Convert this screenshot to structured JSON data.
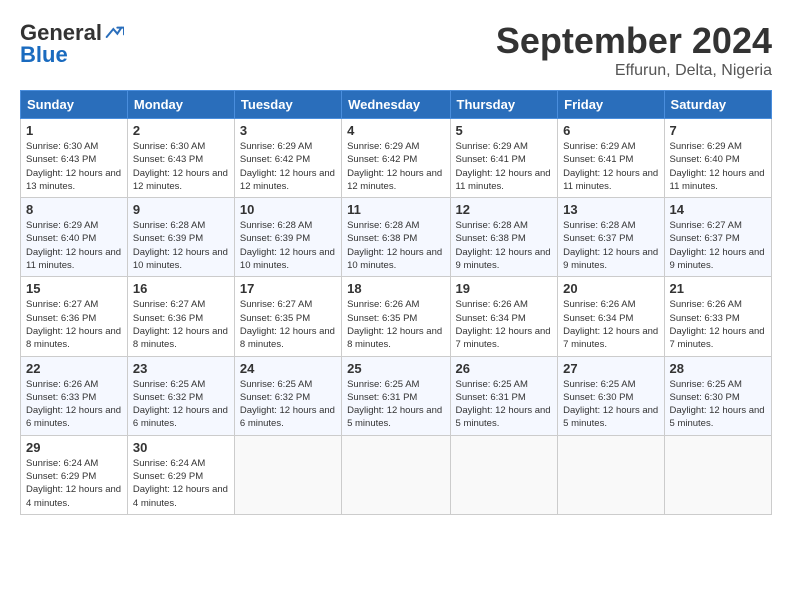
{
  "logo": {
    "general": "General",
    "blue": "Blue"
  },
  "header": {
    "month": "September 2024",
    "location": "Effurun, Delta, Nigeria"
  },
  "days": [
    "Sunday",
    "Monday",
    "Tuesday",
    "Wednesday",
    "Thursday",
    "Friday",
    "Saturday"
  ],
  "weeks": [
    [
      {
        "day": "1",
        "sunrise": "6:30 AM",
        "sunset": "6:43 PM",
        "daylight": "12 hours and 13 minutes."
      },
      {
        "day": "2",
        "sunrise": "6:30 AM",
        "sunset": "6:43 PM",
        "daylight": "12 hours and 12 minutes."
      },
      {
        "day": "3",
        "sunrise": "6:29 AM",
        "sunset": "6:42 PM",
        "daylight": "12 hours and 12 minutes."
      },
      {
        "day": "4",
        "sunrise": "6:29 AM",
        "sunset": "6:42 PM",
        "daylight": "12 hours and 12 minutes."
      },
      {
        "day": "5",
        "sunrise": "6:29 AM",
        "sunset": "6:41 PM",
        "daylight": "12 hours and 11 minutes."
      },
      {
        "day": "6",
        "sunrise": "6:29 AM",
        "sunset": "6:41 PM",
        "daylight": "12 hours and 11 minutes."
      },
      {
        "day": "7",
        "sunrise": "6:29 AM",
        "sunset": "6:40 PM",
        "daylight": "12 hours and 11 minutes."
      }
    ],
    [
      {
        "day": "8",
        "sunrise": "6:29 AM",
        "sunset": "6:40 PM",
        "daylight": "12 hours and 11 minutes."
      },
      {
        "day": "9",
        "sunrise": "6:28 AM",
        "sunset": "6:39 PM",
        "daylight": "12 hours and 10 minutes."
      },
      {
        "day": "10",
        "sunrise": "6:28 AM",
        "sunset": "6:39 PM",
        "daylight": "12 hours and 10 minutes."
      },
      {
        "day": "11",
        "sunrise": "6:28 AM",
        "sunset": "6:38 PM",
        "daylight": "12 hours and 10 minutes."
      },
      {
        "day": "12",
        "sunrise": "6:28 AM",
        "sunset": "6:38 PM",
        "daylight": "12 hours and 9 minutes."
      },
      {
        "day": "13",
        "sunrise": "6:28 AM",
        "sunset": "6:37 PM",
        "daylight": "12 hours and 9 minutes."
      },
      {
        "day": "14",
        "sunrise": "6:27 AM",
        "sunset": "6:37 PM",
        "daylight": "12 hours and 9 minutes."
      }
    ],
    [
      {
        "day": "15",
        "sunrise": "6:27 AM",
        "sunset": "6:36 PM",
        "daylight": "12 hours and 8 minutes."
      },
      {
        "day": "16",
        "sunrise": "6:27 AM",
        "sunset": "6:36 PM",
        "daylight": "12 hours and 8 minutes."
      },
      {
        "day": "17",
        "sunrise": "6:27 AM",
        "sunset": "6:35 PM",
        "daylight": "12 hours and 8 minutes."
      },
      {
        "day": "18",
        "sunrise": "6:26 AM",
        "sunset": "6:35 PM",
        "daylight": "12 hours and 8 minutes."
      },
      {
        "day": "19",
        "sunrise": "6:26 AM",
        "sunset": "6:34 PM",
        "daylight": "12 hours and 7 minutes."
      },
      {
        "day": "20",
        "sunrise": "6:26 AM",
        "sunset": "6:34 PM",
        "daylight": "12 hours and 7 minutes."
      },
      {
        "day": "21",
        "sunrise": "6:26 AM",
        "sunset": "6:33 PM",
        "daylight": "12 hours and 7 minutes."
      }
    ],
    [
      {
        "day": "22",
        "sunrise": "6:26 AM",
        "sunset": "6:33 PM",
        "daylight": "12 hours and 6 minutes."
      },
      {
        "day": "23",
        "sunrise": "6:25 AM",
        "sunset": "6:32 PM",
        "daylight": "12 hours and 6 minutes."
      },
      {
        "day": "24",
        "sunrise": "6:25 AM",
        "sunset": "6:32 PM",
        "daylight": "12 hours and 6 minutes."
      },
      {
        "day": "25",
        "sunrise": "6:25 AM",
        "sunset": "6:31 PM",
        "daylight": "12 hours and 5 minutes."
      },
      {
        "day": "26",
        "sunrise": "6:25 AM",
        "sunset": "6:31 PM",
        "daylight": "12 hours and 5 minutes."
      },
      {
        "day": "27",
        "sunrise": "6:25 AM",
        "sunset": "6:30 PM",
        "daylight": "12 hours and 5 minutes."
      },
      {
        "day": "28",
        "sunrise": "6:25 AM",
        "sunset": "6:30 PM",
        "daylight": "12 hours and 5 minutes."
      }
    ],
    [
      {
        "day": "29",
        "sunrise": "6:24 AM",
        "sunset": "6:29 PM",
        "daylight": "12 hours and 4 minutes."
      },
      {
        "day": "30",
        "sunrise": "6:24 AM",
        "sunset": "6:29 PM",
        "daylight": "12 hours and 4 minutes."
      },
      null,
      null,
      null,
      null,
      null
    ]
  ],
  "labels": {
    "sunrise": "Sunrise:",
    "sunset": "Sunset:",
    "daylight": "Daylight:"
  }
}
